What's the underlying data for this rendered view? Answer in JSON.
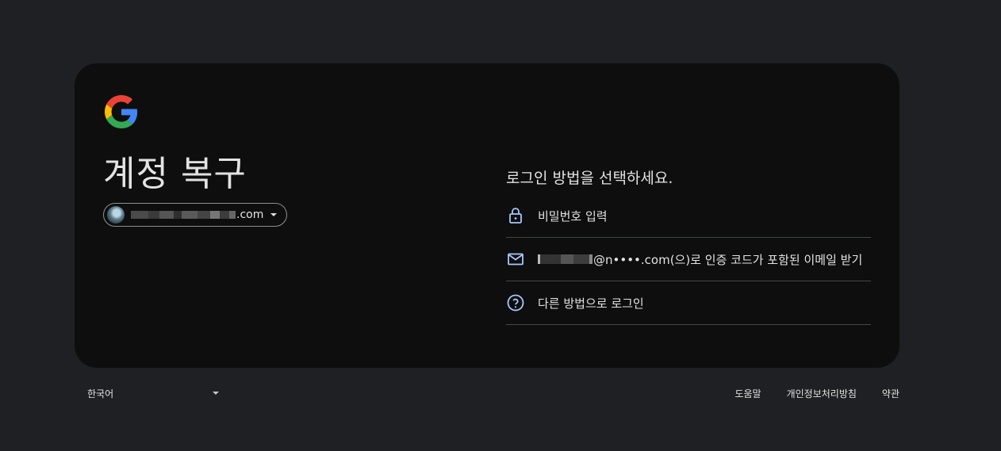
{
  "page": {
    "title": "계정 복구",
    "prompt": "로그인 방법을 선택하세요."
  },
  "account": {
    "email_visible_suffix": ".com",
    "email_masked": true
  },
  "options": [
    {
      "icon": "lock-icon",
      "label": "비밀번호 입력"
    },
    {
      "icon": "mail-icon",
      "label": "@n••••.com(으)로 인증 코드가 포함된 이메일 받기",
      "masked_prefix": true
    },
    {
      "icon": "help-circle-icon",
      "label": "다른 방법으로 로그인"
    }
  ],
  "footer": {
    "language": "한국어",
    "links": [
      "도움말",
      "개인정보처리방침",
      "약관"
    ]
  },
  "colors": {
    "page_bg": "#1f2023",
    "card_bg": "#0e0e0f",
    "text": "#e3e3e3",
    "icon_accent": "#a8c7fa",
    "divider": "#444746"
  }
}
